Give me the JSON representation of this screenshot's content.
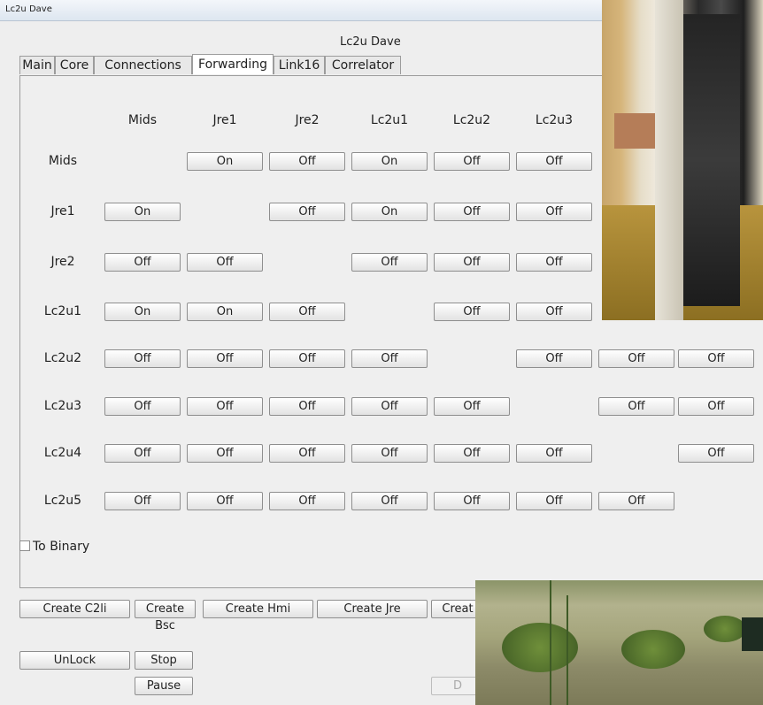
{
  "window": {
    "title": "Lc2u Dave"
  },
  "app": {
    "title": "Lc2u Dave"
  },
  "tabs": [
    {
      "label": "Main"
    },
    {
      "label": "Core"
    },
    {
      "label": "Connections"
    },
    {
      "label": "Forwarding"
    },
    {
      "label": "Link16"
    },
    {
      "label": "Correlator"
    }
  ],
  "active_tab": "Forwarding",
  "forwarding": {
    "columns": [
      "Mids",
      "Jre1",
      "Jre2",
      "Lc2u1",
      "Lc2u2",
      "Lc2u3"
    ],
    "rows": [
      {
        "label": "Mids",
        "states": [
          "",
          "On",
          "Off",
          "On",
          "Off",
          "Off"
        ]
      },
      {
        "label": "Jre1",
        "states": [
          "On",
          "",
          "Off",
          "On",
          "Off",
          "Off"
        ]
      },
      {
        "label": "Jre2",
        "states": [
          "Off",
          "Off",
          "",
          "Off",
          "Off",
          "Off"
        ]
      },
      {
        "label": "Lc2u1",
        "states": [
          "On",
          "On",
          "Off",
          "",
          "Off",
          "Off"
        ]
      },
      {
        "label": "Lc2u2",
        "states": [
          "Off",
          "Off",
          "Off",
          "Off",
          "",
          "Off",
          "Off",
          "Off"
        ]
      },
      {
        "label": "Lc2u3",
        "states": [
          "Off",
          "Off",
          "Off",
          "Off",
          "Off",
          "",
          "Off",
          "Off"
        ]
      },
      {
        "label": "Lc2u4",
        "states": [
          "Off",
          "Off",
          "Off",
          "Off",
          "Off",
          "Off",
          "",
          "Off"
        ]
      },
      {
        "label": "Lc2u5",
        "states": [
          "Off",
          "Off",
          "Off",
          "Off",
          "Off",
          "Off",
          "Off",
          ""
        ]
      }
    ]
  },
  "to_binary": {
    "label": "To Binary",
    "checked": false
  },
  "create_buttons": [
    {
      "label": "Create C2li"
    },
    {
      "label": "Create Bsc"
    },
    {
      "label": "Create Hmi"
    },
    {
      "label": "Create Jre"
    },
    {
      "label": "Creat"
    }
  ],
  "controls": {
    "unlock": "UnLock",
    "stop": "Stop",
    "pause": "Pause",
    "disabled_partial": "D"
  }
}
